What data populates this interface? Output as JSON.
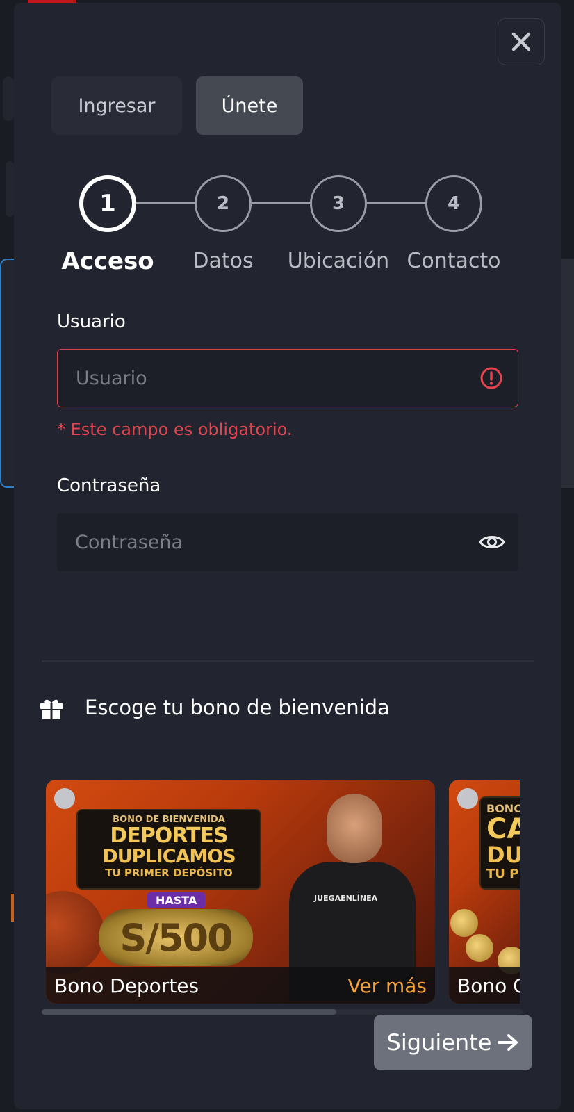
{
  "tabs": [
    {
      "label": "Ingresar"
    },
    {
      "label": "Únete"
    }
  ],
  "steps": [
    {
      "number": "1",
      "label": "Acceso"
    },
    {
      "number": "2",
      "label": "Datos"
    },
    {
      "number": "3",
      "label": "Ubicación"
    },
    {
      "number": "4",
      "label": "Contacto"
    }
  ],
  "form": {
    "username_label": "Usuario",
    "username_placeholder": "Usuario",
    "username_error": "* Este campo es obligatorio.",
    "password_label": "Contraseña",
    "password_placeholder": "Contraseña"
  },
  "bonus": {
    "heading": "Escoge tu bono de bienvenida",
    "cards": [
      {
        "title": "Bono Deportes",
        "more": "Ver más",
        "promo_line1": "BONO DE BIENVENIDA",
        "promo_line2": "DEPORTES",
        "promo_line3": "DUPLICAMOS",
        "promo_line4": "TU PRIMER DEPÓSITO",
        "promo_hasta": "HASTA",
        "promo_amount": "S/500",
        "shirt_text": "JUEGAENLÍNEA"
      },
      {
        "title": "Bono Ca",
        "promo_line1": "BONO",
        "promo_line2": "CA",
        "promo_line3": "DUP",
        "promo_line4": "TU PR"
      }
    ]
  },
  "next_button": {
    "label": "Siguiente"
  },
  "colors": {
    "modal_bg": "#22252f",
    "error": "#e5444f",
    "accent_more": "#f4a33b",
    "button_bg": "#6c717b"
  }
}
